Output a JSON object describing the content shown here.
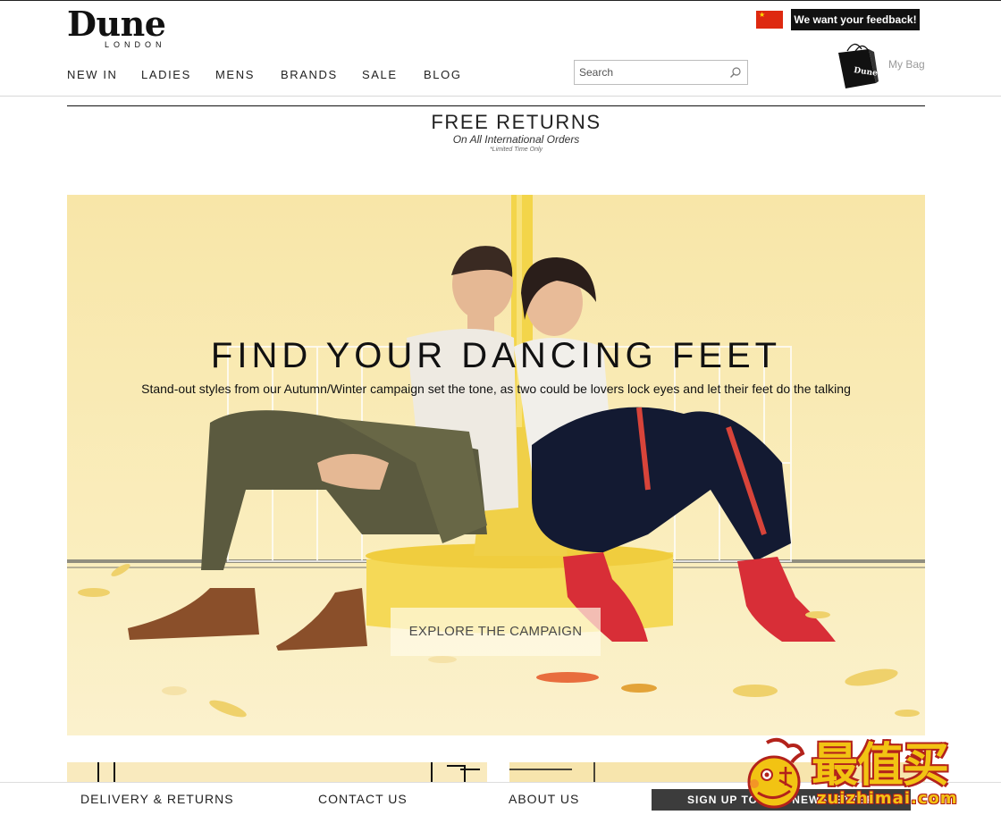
{
  "header": {
    "logo_main": "Dune",
    "logo_sub": "LONDON",
    "flag": "china-flag",
    "feedback_label": "We want your feedback!",
    "nav": [
      {
        "label": "NEW IN"
      },
      {
        "label": "LADIES"
      },
      {
        "label": "MENS"
      },
      {
        "label": "BRANDS"
      },
      {
        "label": "SALE"
      },
      {
        "label": "BLOG"
      }
    ],
    "search": {
      "placeholder": "Search",
      "value": "",
      "icon": "search-icon"
    },
    "bag": {
      "label": "My Bag",
      "icon": "shopping-bag-icon",
      "bag_print": "Dune"
    }
  },
  "promo": {
    "title": "FREE RETURNS",
    "subtitle": "On All International Orders",
    "note": "*Limited Time Only"
  },
  "hero": {
    "title": "FIND YOUR DANCING FEET",
    "subtitle": "Stand-out styles from our Autumn/Winter campaign set the tone, as two could be lovers lock eyes and let their feet do the talking",
    "cta": "EXPLORE THE CAMPAIGN",
    "photo": "couple-sitting-back-to-back-photo"
  },
  "footer": {
    "links": [
      {
        "label": "DELIVERY & RETURNS"
      },
      {
        "label": "CONTACT US"
      },
      {
        "label": "ABOUT US"
      }
    ],
    "signup": "SIGN UP TO OUR NEWSLETTER"
  },
  "watermark": {
    "cn": "最值买",
    "en": "zuizhimai.com"
  },
  "colors": {
    "hero_bg": "#f8e7ae",
    "chair": "#f5d957",
    "footer_button": "#3c3c3c",
    "flag_red": "#de2910",
    "watermark_yellow": "#f2c313"
  }
}
